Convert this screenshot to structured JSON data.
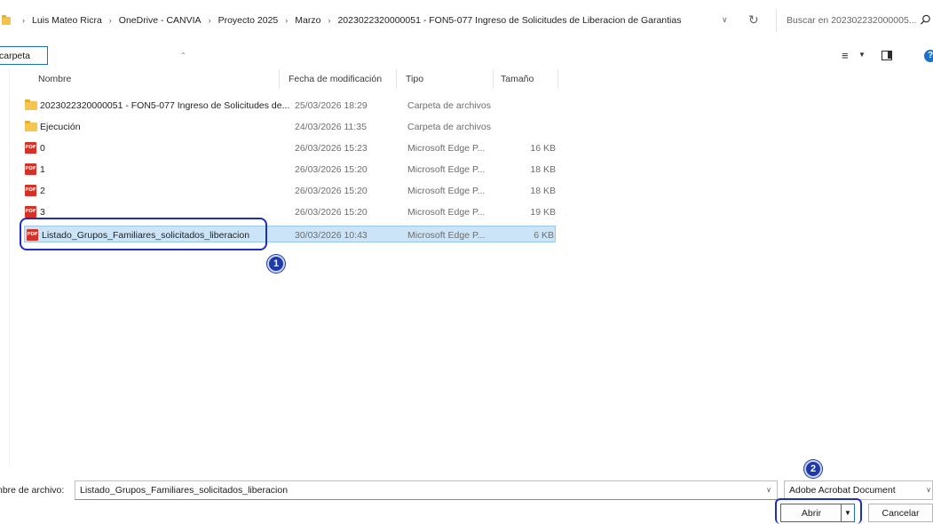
{
  "address": {
    "crumbs": [
      "Luis Mateo Ricra",
      "OneDrive - CANVIA",
      "Proyecto 2025",
      "Marzo",
      "2023022320000051 - FON5-077 Ingreso de Solicitudes de Liberacion de Garantias"
    ],
    "separator": "›"
  },
  "search": {
    "placeholder": "Buscar en 202302232000005..."
  },
  "toolbar": {
    "new_folder_label": "carpeta"
  },
  "columns": {
    "name": "Nombre",
    "date": "Fecha de modificación",
    "type": "Tipo",
    "size": "Tamaño"
  },
  "files": [
    {
      "icon": "folder-icon",
      "name": "2023022320000051 - FON5-077 Ingreso de Solicitudes de...",
      "date": "25/03/2026 18:29",
      "type": "Carpeta de archivos",
      "size": ""
    },
    {
      "icon": "folder-icon",
      "name": "Ejecución",
      "date": "24/03/2026 11:35",
      "type": "Carpeta de archivos",
      "size": ""
    },
    {
      "icon": "pdf-icon",
      "name": "0",
      "date": "26/03/2026 15:23",
      "type": "Microsoft Edge P...",
      "size": "16 KB"
    },
    {
      "icon": "pdf-icon",
      "name": "1",
      "date": "26/03/2026 15:20",
      "type": "Microsoft Edge P...",
      "size": "18 KB"
    },
    {
      "icon": "pdf-icon",
      "name": "2",
      "date": "26/03/2026 15:20",
      "type": "Microsoft Edge P...",
      "size": "18 KB"
    },
    {
      "icon": "pdf-icon",
      "name": "3",
      "date": "26/03/2026 15:20",
      "type": "Microsoft Edge P...",
      "size": "19 KB"
    },
    {
      "icon": "pdf-icon",
      "name": "Listado_Grupos_Familiares_solicitados_liberacion",
      "date": "30/03/2026 10:43",
      "type": "Microsoft Edge P...",
      "size": "6 KB",
      "selected": true
    }
  ],
  "annotations": {
    "step1": "1",
    "step2": "2",
    "accent": "#1f2ec4"
  },
  "bottom": {
    "filename_label": "nbre de archivo:",
    "filename_value": "Listado_Grupos_Familiares_solicitados_liberacion",
    "filter_value": "Adobe Acrobat Document",
    "open_label": "Abrir",
    "cancel_label": "Cancelar"
  },
  "pdf_icon_text": "PDF"
}
